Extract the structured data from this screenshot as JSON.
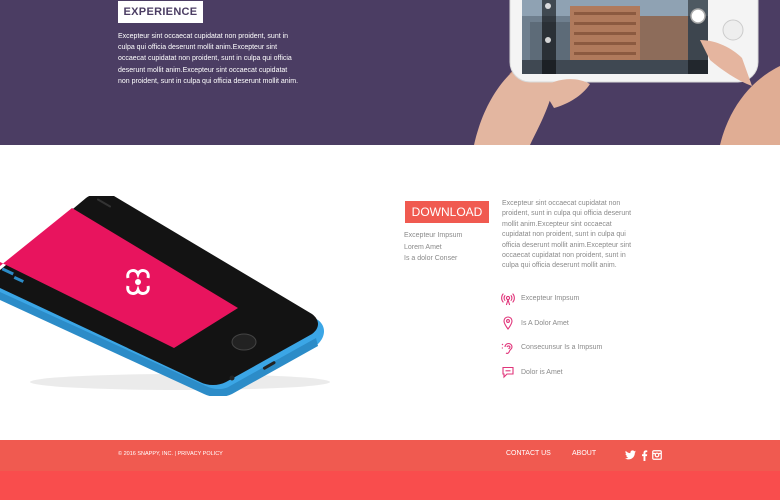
{
  "experience": {
    "badge_label": "EXPERIENCE",
    "text": "Excepteur sint occaecat cupidatat non proident, sunt in culpa qui officia deserunt mollit anim.Excepteur sint occaecat cupidatat non proident, sunt in culpa qui officia deserunt mollit anim.Excepteur sint occaecat cupidatat non proident, sunt in culpa qui officia deserunt mollit anim."
  },
  "download": {
    "button_label": "DOWNLOAD",
    "links": [
      "Excepteur Impsum",
      "Lorem Amet",
      "Is a dolor Conser"
    ],
    "text": "Excepteur sint occaecat cupidatat non proident, sunt in culpa qui officia deserunt mollit anim.Excepteur sint occaecat cupidatat non proident, sunt in culpa qui officia deserunt mollit anim.Excepteur sint occaecat cupidatat non proident, sunt in culpa qui officia deserunt mollit anim."
  },
  "features": [
    {
      "icon": "broadcast-icon",
      "label": "Excepteur Impsum"
    },
    {
      "icon": "location-pin-icon",
      "label": "Is A Dolor Amet"
    },
    {
      "icon": "ear-icon",
      "label": "Consecunsur Is a Impsum"
    },
    {
      "icon": "chat-icon",
      "label": "Dolor is Amet"
    }
  ],
  "footer": {
    "copyright": "© 2016 SNAPPY, INC.",
    "separator": "|",
    "privacy_label": "PRIVACY POLICY",
    "nav": [
      "CONTACT US",
      "ABOUT"
    ],
    "social": [
      "twitter-icon",
      "facebook-icon",
      "instagram-icon"
    ]
  },
  "colors": {
    "hero_bg": "#4b3d63",
    "accent": "#f05a50",
    "feature_icon": "#e0357a",
    "phone_screen": "#e8145e",
    "phone_body": "#3ba6e6"
  }
}
